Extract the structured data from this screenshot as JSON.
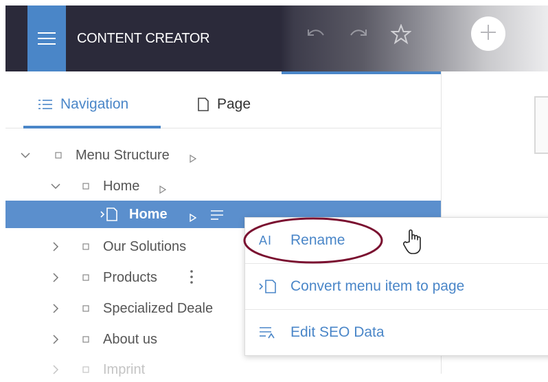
{
  "header": {
    "app_title": "CONTENT CREATOR",
    "icons": [
      "menu-icon",
      "undo-icon",
      "redo-icon",
      "star-icon",
      "add-icon"
    ]
  },
  "tabs": [
    {
      "label": "Navigation",
      "icon": "list-icon",
      "active": true
    },
    {
      "label": "Page",
      "icon": "page-icon",
      "active": false
    }
  ],
  "tree": {
    "items": [
      {
        "label": "Menu Structure",
        "expanded": true,
        "level": 0
      },
      {
        "label": "Home",
        "expanded": true,
        "level": 1
      },
      {
        "label": "Home",
        "level": 2,
        "selected": true
      },
      {
        "label": "Our Solutions",
        "expanded": false,
        "level": 1
      },
      {
        "label": "Products",
        "expanded": false,
        "level": 1
      },
      {
        "label": "Specialized Deale",
        "expanded": false,
        "level": 1
      },
      {
        "label": "About us",
        "expanded": false,
        "level": 1
      },
      {
        "label": "Imprint",
        "expanded": false,
        "level": 1
      }
    ]
  },
  "context_menu": {
    "items": [
      {
        "label": "Rename",
        "icon": "rename-icon",
        "icon_text": "AI"
      },
      {
        "label": "Convert menu item to page",
        "icon": "convert-page-icon"
      },
      {
        "label": "Edit SEO Data",
        "icon": "seo-icon"
      }
    ]
  },
  "colors": {
    "accent": "#4a86c8",
    "selected_row": "#5b8fcd",
    "topbar": "#2b2a3a",
    "highlight_ellipse": "#7a1030"
  }
}
